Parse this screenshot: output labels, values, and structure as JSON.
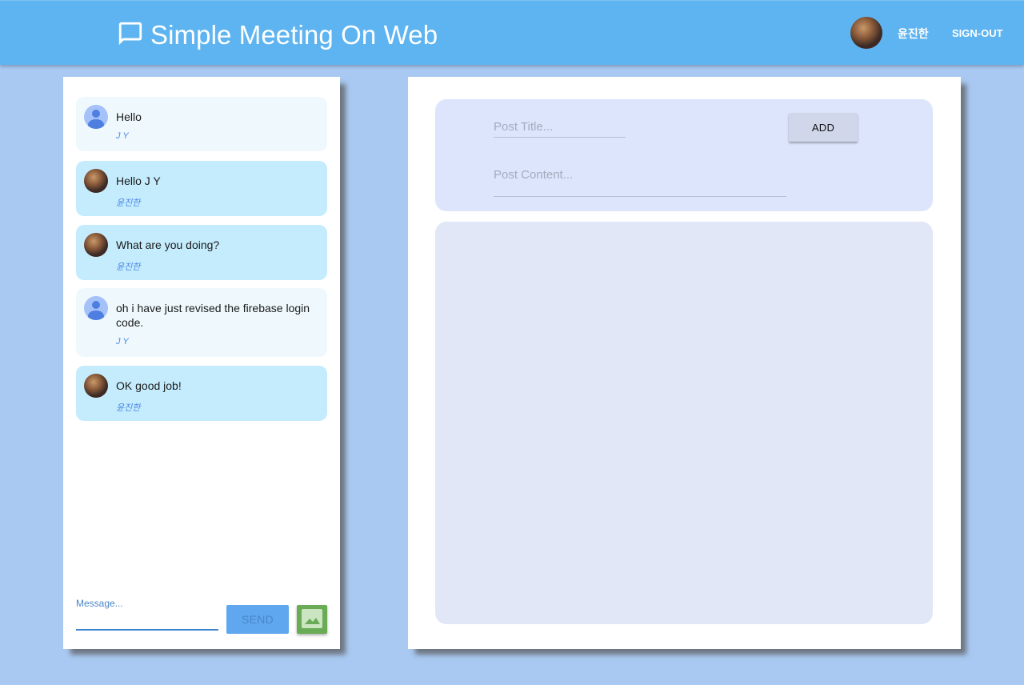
{
  "header": {
    "title": "Simple Meeting On Web",
    "icon": "chat-bubble-icon",
    "user_name": "윤진한",
    "signout_label": "SIGN-OUT"
  },
  "chat": {
    "messages": [
      {
        "text": "Hello",
        "author": "J Y",
        "type": "other",
        "avatar": "default-avatar"
      },
      {
        "text": "Hello J Y",
        "author": "윤진한",
        "type": "mine",
        "avatar": "photo-avatar"
      },
      {
        "text": "What are you doing?",
        "author": "윤진한",
        "type": "mine",
        "avatar": "photo-avatar"
      },
      {
        "text": "oh i have just revised the firebase login code.",
        "author": "J Y",
        "type": "other",
        "avatar": "default-avatar"
      },
      {
        "text": "OK good job!",
        "author": "윤진한",
        "type": "mine",
        "avatar": "photo-avatar"
      }
    ],
    "composer": {
      "label": "Message...",
      "value": "",
      "send_label": "SEND",
      "image_button_icon": "image-icon"
    }
  },
  "board": {
    "post_title_placeholder": "Post Title...",
    "post_content_placeholder": "Post Content...",
    "add_label": "ADD",
    "posts": []
  },
  "colors": {
    "appbar": "#5eb4f0",
    "background": "#a9c9f2",
    "mine_bubble": "#c4ecfd",
    "other_bubble": "#eff9fd",
    "send_button": "#5fa7ef",
    "image_button": "#6aac55",
    "post_form": "#dce5fc",
    "post_list": "#e1e7f7"
  }
}
